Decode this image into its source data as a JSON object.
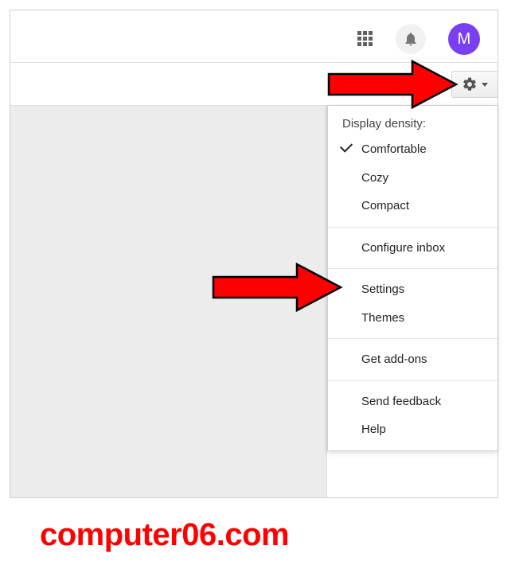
{
  "avatar": {
    "initial": "M"
  },
  "menu": {
    "header": "Display density:",
    "density": {
      "comfortable": "Comfortable",
      "cozy": "Cozy",
      "compact": "Compact"
    },
    "configure_inbox": "Configure inbox",
    "settings": "Settings",
    "themes": "Themes",
    "get_addons": "Get add-ons",
    "send_feedback": "Send feedback",
    "help": "Help"
  },
  "watermark": "computer06.com"
}
